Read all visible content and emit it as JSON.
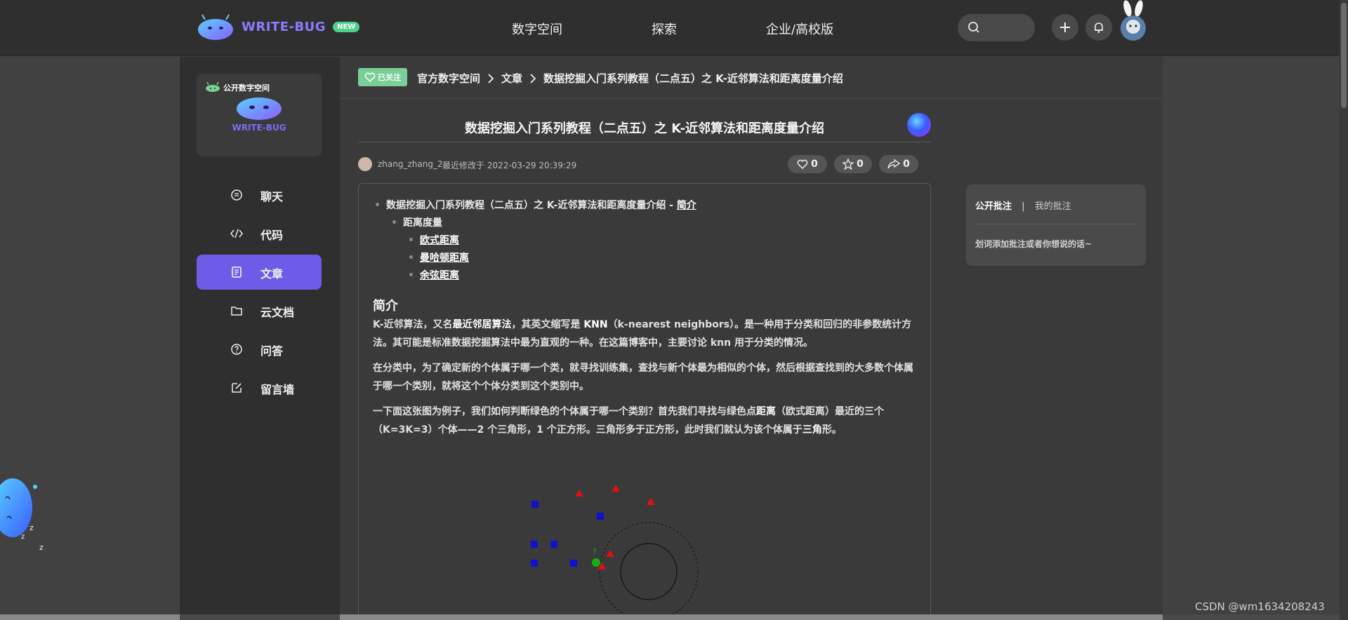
{
  "topbar": {
    "logo_text": "WRITE-BUG",
    "logo_badge": "NEW",
    "nav": [
      "数字空间",
      "探索",
      "企业/高校版"
    ]
  },
  "sidebar": {
    "space_label": "公开数字空间",
    "space_brand": "WRITE-BUG",
    "items": [
      {
        "label": "聊天",
        "icon": "chat-icon"
      },
      {
        "label": "代码",
        "icon": "code-icon"
      },
      {
        "label": "文章",
        "icon": "article-icon",
        "active": true
      },
      {
        "label": "云文档",
        "icon": "folder-icon"
      },
      {
        "label": "问答",
        "icon": "question-icon"
      },
      {
        "label": "留言墙",
        "icon": "edit-icon"
      }
    ]
  },
  "breadcrumb": {
    "followed": "已关注",
    "crumbs": [
      "官方数字空间",
      "文章",
      "数据挖掘入门系列教程（二点五）之 K-近邻算法和距离度量介绍"
    ]
  },
  "article": {
    "title": "数据挖掘入门系列教程（二点五）之 K-近邻算法和距离度量介绍",
    "author": "zhang_zhang_2",
    "edited": "最近修改于 2022-03-29 20:39:29",
    "likes": "0",
    "stars": "0",
    "shares": "0",
    "toc": {
      "root_prefix": "数据挖掘入门系列教程（二点五）之 K-近邻算法和距离度量介绍 - ",
      "root_link": "简介",
      "sub": "距离度量",
      "items": [
        "欧式距离",
        "曼哈顿距离",
        "余弦距离"
      ]
    },
    "heading": "简介",
    "para1_a": "K-近邻算法，又名",
    "para1_b": "最近邻居算法",
    "para1_c": "，其英文缩写是 ",
    "para1_d": "KNN",
    "para1_e": "（k-nearest neighbors）。是一种用于分类和回归的非参数统计方法。其可能是标准数据挖掘算法中最为直观的一种。在这篇博客中，主要讨论 knn 用于分类的情况。",
    "para2": "在分类中，为了确定新的个体属于哪一个类，就寻找训练集，查找与新个体最为相似的个体，然后根据查找到的大多数个体属于哪一个类别，就将这个个体分类到这个类别中。",
    "para3_a": "一下面这张图为例子，我们如何判断绿色的个体属于哪一个类别？首先我们寻找与绿色点",
    "para3_b": "距离",
    "para3_c": "（欧式距离）最近的三个（K=3K=3）个体——2 个三角形，1 个正方形。三角形多于正方形，此时我们就认为该个体属于",
    "para3_d": "三角",
    "para3_e": "形。",
    "figure_label": "?"
  },
  "annotations": {
    "tab_public": "公开批注",
    "separator": "|",
    "tab_mine": "我的批注",
    "hint": "划词添加批注或者你想说的话~"
  },
  "watermark": "CSDN @wm1634208243",
  "colors": {
    "accent": "#6c5ce7",
    "followed": "#79cf96",
    "new_badge": "#4fd18b",
    "triangle": "#e01010",
    "square": "#1010d0",
    "query_point": "#10b010"
  }
}
